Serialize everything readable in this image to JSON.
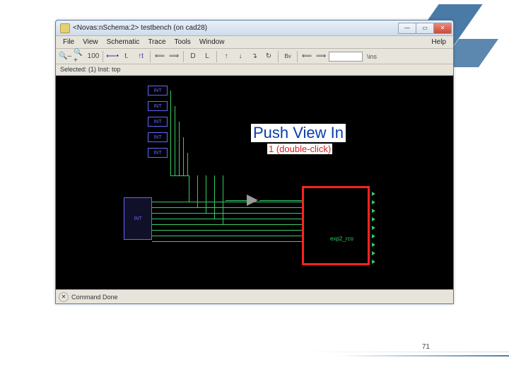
{
  "window": {
    "title": "<Novas:nSchema:2> testbench (on cad28)"
  },
  "menu": {
    "file": "File",
    "view": "View",
    "schematic": "Schematic",
    "trace": "Trace",
    "tools": "Tools",
    "window": "Window",
    "help": "Help"
  },
  "toolbar": {
    "zoom_pct": "100",
    "pct_sign": "%",
    "search_value": "",
    "search_hint": "\\ins"
  },
  "status_top": "Selected: (1) Inst: top",
  "status_bottom": "Command Done",
  "schematic": {
    "int_label": "INT",
    "module_label": "exp2_rco"
  },
  "overlay": {
    "title": "Push View In",
    "caption": "1 (double-click)"
  },
  "page_number": "71"
}
